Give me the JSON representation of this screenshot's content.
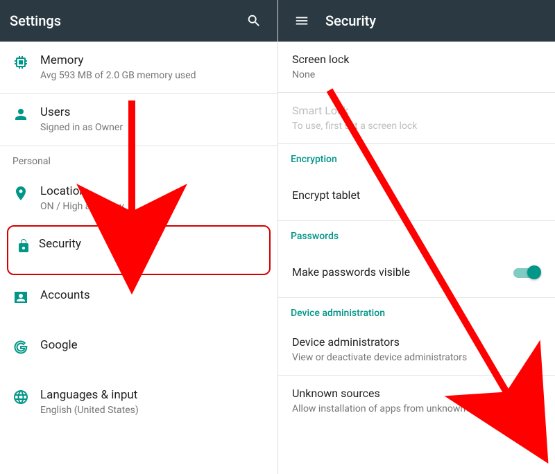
{
  "left": {
    "title": "Settings",
    "sections": [
      {
        "items": [
          {
            "key": "memory",
            "label": "Memory",
            "sub": "Avg 593 MB of 2.0 GB memory used"
          },
          {
            "key": "users",
            "label": "Users",
            "sub": "Signed in as Owner"
          }
        ]
      },
      {
        "header": "Personal",
        "items": [
          {
            "key": "location",
            "label": "Location",
            "sub": "ON / High accuracy"
          },
          {
            "key": "security",
            "label": "Security",
            "highlight": true
          },
          {
            "key": "accounts",
            "label": "Accounts"
          },
          {
            "key": "google",
            "label": "Google"
          },
          {
            "key": "languages",
            "label": "Languages & input",
            "sub": "English (United States)"
          }
        ]
      }
    ]
  },
  "right": {
    "title": "Security",
    "groups": [
      {
        "items": [
          {
            "key": "screenlock",
            "label": "Screen lock",
            "sub": "None"
          },
          {
            "key": "smartlock",
            "label": "Smart Lock",
            "sub": "To use, first set a screen lock",
            "disabled": true
          }
        ]
      },
      {
        "header": "Encryption",
        "items": [
          {
            "key": "encrypt",
            "label": "Encrypt tablet"
          }
        ]
      },
      {
        "header": "Passwords",
        "items": [
          {
            "key": "pwvisible",
            "label": "Make passwords visible",
            "toggle": true
          }
        ]
      },
      {
        "header": "Device administration",
        "items": [
          {
            "key": "devadmin",
            "label": "Device administrators",
            "sub": "View or deactivate device administrators"
          },
          {
            "key": "unknown",
            "label": "Unknown sources",
            "sub": "Allow installation of apps from unknown sources",
            "toggle": true
          }
        ]
      }
    ]
  }
}
